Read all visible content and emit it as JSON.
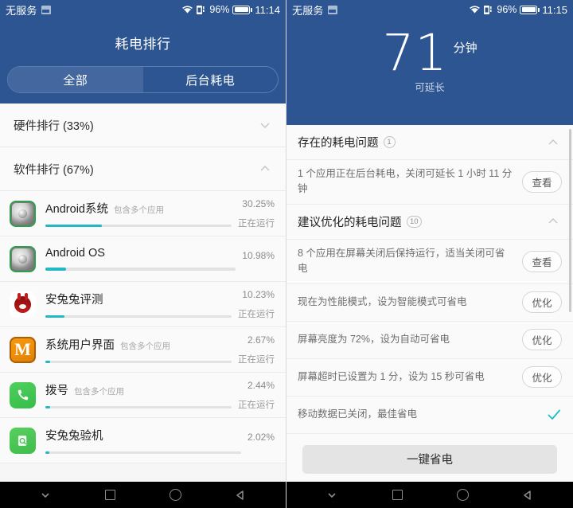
{
  "left": {
    "status_bar": {
      "carrier": "无服务",
      "sim_icon": "sim-card-icon",
      "wifi_icon": "wifi-icon",
      "signal_icon": "signal-icon",
      "battery_percent": "96%",
      "battery_icon": "battery-icon",
      "time": "11:14"
    },
    "header": {
      "title": "耗电排行",
      "tabs": [
        {
          "label": "全部",
          "active": true
        },
        {
          "label": "后台耗电",
          "active": false
        }
      ]
    },
    "groups": [
      {
        "title": "硬件排行 (33%)",
        "chevron": "chevron-down-icon",
        "expanded": false
      },
      {
        "title": "软件排行 (67%)",
        "chevron": "chevron-up-icon",
        "expanded": true
      }
    ],
    "apps": [
      {
        "icon": "android-system-icon",
        "name": "Android系统",
        "sub": "包含多个应用",
        "percent": "30.25%",
        "state": "正在运行",
        "bar": 30.25
      },
      {
        "icon": "android-os-icon",
        "name": "Android OS",
        "sub": "",
        "percent": "10.98%",
        "state": "",
        "bar": 10.98
      },
      {
        "icon": "antutu-benchmark-icon",
        "name": "安兔兔评测",
        "sub": "",
        "percent": "10.23%",
        "state": "正在运行",
        "bar": 10.23
      },
      {
        "icon": "system-ui-icon",
        "name": "系统用户界面",
        "sub": "包含多个应用",
        "percent": "2.67%",
        "state": "正在运行",
        "bar": 2.67
      },
      {
        "icon": "dialer-icon",
        "name": "拨号",
        "sub": "包含多个应用",
        "percent": "2.44%",
        "state": "正在运行",
        "bar": 2.44
      },
      {
        "icon": "antutu-verify-icon",
        "name": "安兔兔验机",
        "sub": "",
        "percent": "2.02%",
        "state": "",
        "bar": 2.02
      }
    ]
  },
  "right": {
    "status_bar": {
      "carrier": "无服务",
      "sim_icon": "sim-card-icon",
      "wifi_icon": "wifi-icon",
      "signal_icon": "signal-icon",
      "battery_percent": "96%",
      "battery_icon": "battery-icon",
      "time": "11:15"
    },
    "hero": {
      "value": "71",
      "unit": "分钟",
      "caption": "可延长"
    },
    "sections": [
      {
        "title": "存在的耗电问题",
        "badge": "1",
        "chevron": "chevron-up-icon",
        "items": [
          {
            "text": "1 个应用正在后台耗电，关闭可延长 1 小时 11 分钟",
            "action": "查看",
            "type": "button"
          }
        ]
      },
      {
        "title": "建议优化的耗电问题",
        "badge": "10",
        "chevron": "chevron-up-icon",
        "items": [
          {
            "text": "8 个应用在屏幕关闭后保持运行，适当关闭可省电",
            "action": "查看",
            "type": "button"
          },
          {
            "text": "现在为性能模式，设为智能模式可省电",
            "action": "优化",
            "type": "button"
          },
          {
            "text": "屏幕亮度为 72%，设为自动可省电",
            "action": "优化",
            "type": "button"
          },
          {
            "text": "屏幕超时已设置为 1 分，设为 15 秒可省电",
            "action": "优化",
            "type": "button"
          },
          {
            "text": "移动数据已关闭，最佳省电",
            "action": "check-icon",
            "type": "check"
          }
        ]
      }
    ],
    "cta_label": "一键省电"
  },
  "navbar": {
    "items": [
      "chevron-down-icon",
      "recents-square-icon",
      "home-circle-icon",
      "back-triangle-icon"
    ]
  },
  "colors": {
    "brand_blue": "#2d5591",
    "tab_active": "#43679e",
    "accent_teal": "#22b8c4",
    "surface": "#fafafa"
  }
}
